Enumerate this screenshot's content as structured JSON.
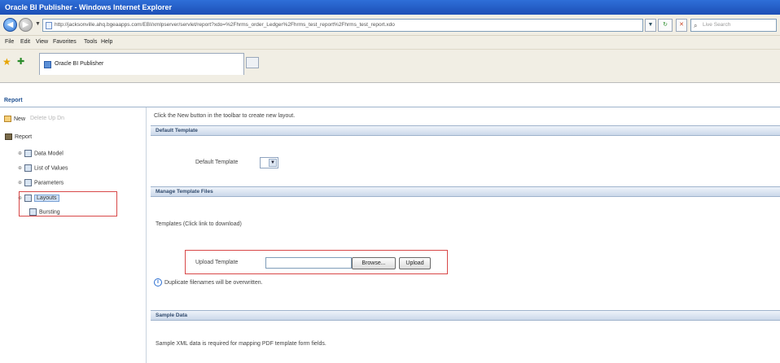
{
  "window": {
    "title": "Oracle BI Publisher - Windows Internet Explorer"
  },
  "address_bar": {
    "url": "http://jacksonville.ahq.bgeaapps.com/EBI/xmlpserver/servlet/report?xdo=%2Fhrms_order_Ledger%2Fhrms_test_report%2Fhrms_test_report.xdo",
    "search_placeholder": "Live Search"
  },
  "menu": {
    "items": [
      "File",
      "Edit",
      "View",
      "Favorites",
      "Tools",
      "Help"
    ]
  },
  "tabs": [
    {
      "label": "Oracle BI Publisher"
    }
  ],
  "page": {
    "report_link": "Report",
    "toolbar": {
      "new": "New",
      "disabled_items": "Delete   Up   Dn"
    },
    "tree": {
      "root": "Report",
      "items": [
        {
          "label": "Data Model"
        },
        {
          "label": "List of Values"
        },
        {
          "label": "Parameters"
        },
        {
          "label": "Layouts"
        },
        {
          "label": "Bursting"
        }
      ]
    },
    "info_text": "Click the New button in the toolbar to create new layout.",
    "sections": {
      "default_template": "Default Template",
      "manage_template_files": "Manage Template Files",
      "sample_data": "Sample Data"
    },
    "default_template_label": "Default Template",
    "templates_label": "Templates (Click link to download)",
    "upload_template_label": "Upload Template",
    "browse_button": "Browse...",
    "upload_button": "Upload",
    "duplicate_note": "Duplicate filenames will be overwritten.",
    "sample_note": "Sample XML data is required for mapping PDF template form fields."
  }
}
